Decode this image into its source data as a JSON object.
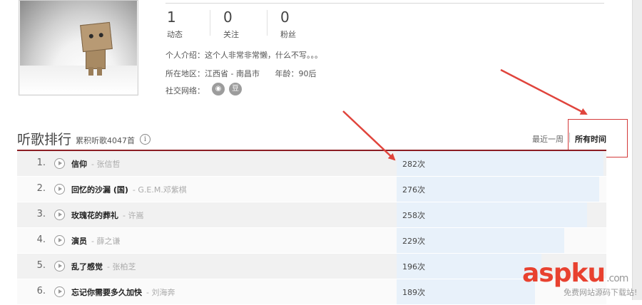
{
  "profile": {
    "stats": [
      {
        "value": "1",
        "label": "动态"
      },
      {
        "value": "0",
        "label": "关注"
      },
      {
        "value": "0",
        "label": "粉丝"
      }
    ],
    "intro": "个人介绍：这个人非常非常懒，什么不写。。。",
    "region_label": "所在地区：",
    "region_value": "江西省 - 南昌市",
    "age_label": "年龄：",
    "age_value": "90后",
    "social_label": "社交网络：",
    "social_icons": [
      "weibo-icon",
      "douban-icon"
    ],
    "social_glyphs": [
      "◉",
      "豆"
    ]
  },
  "ranking": {
    "title": "听歌排行",
    "subtitle": "累积听歌4047首",
    "info_glyph": "i",
    "tabs": {
      "week": "最近一周",
      "all": "所有时间"
    },
    "active_tab": "all",
    "rows": [
      {
        "rank": "1.",
        "song": "信仰",
        "artist": "- 张信哲",
        "count": "282次",
        "fraction": 1.0
      },
      {
        "rank": "2.",
        "song": "回忆的沙漏 (国)",
        "artist": "- G.E.M.邓紫棋",
        "count": "276次",
        "fraction": 0.98
      },
      {
        "rank": "3.",
        "song": "玫瑰花的葬礼",
        "artist": "- 许嵩",
        "count": "258次",
        "fraction": 0.92
      },
      {
        "rank": "4.",
        "song": "演员",
        "artist": "- 薛之谦",
        "count": "229次",
        "fraction": 0.81
      },
      {
        "rank": "5.",
        "song": "乱了感觉",
        "artist": "- 张柏芝",
        "count": "196次",
        "fraction": 0.7
      },
      {
        "rank": "6.",
        "song": "忘记你需要多久加快",
        "artist": "- 刘海奔",
        "count": "189次",
        "fraction": 0.67
      }
    ]
  },
  "colors": {
    "accent_red": "#8b1e23",
    "annotation_red": "#d43a3a",
    "bar_fill": "#e8f1fa"
  },
  "watermark": {
    "asp": "asp",
    "ku": "ku",
    "com": ".com",
    "sub": "免费网站源码下载站!"
  }
}
